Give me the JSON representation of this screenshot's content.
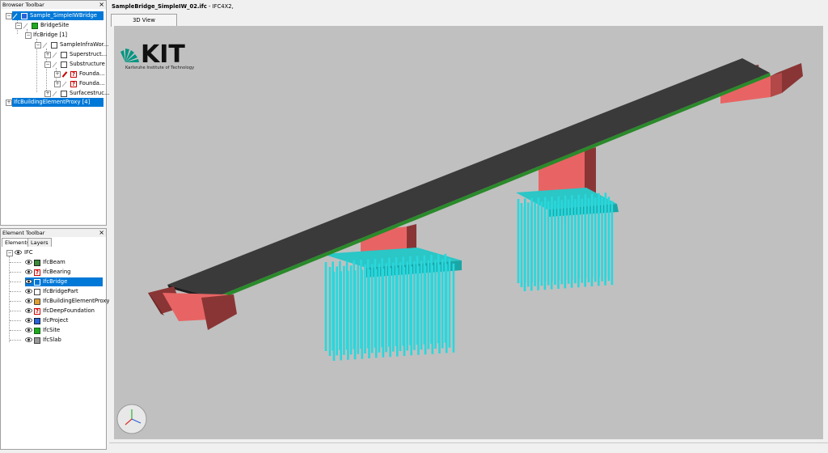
{
  "browser_toolbar": {
    "title": "Browser Toolbar",
    "close": "×",
    "items": [
      {
        "label": "Sample_SimpleIWBridge"
      },
      {
        "label": "BridgeSite"
      },
      {
        "label": "IfcBridge [1]"
      },
      {
        "label": "SampleInfraWor..."
      },
      {
        "label": "Superstruct..."
      },
      {
        "label": "Substructure"
      },
      {
        "label": "Founda..."
      },
      {
        "label": "Founda..."
      },
      {
        "label": "Surfacestruc..."
      },
      {
        "label": "IfcBuildingElementProxy [4]"
      }
    ]
  },
  "element_toolbar": {
    "title": "Element Toolbar",
    "close": "×",
    "tabs": [
      "Elements",
      "Layers"
    ],
    "root": "IFC",
    "items": [
      {
        "label": "IfcBeam"
      },
      {
        "label": "IfcBearing"
      },
      {
        "label": "IfcBridge"
      },
      {
        "label": "IfcBridgePart"
      },
      {
        "label": "IfcBuildingElementProxy"
      },
      {
        "label": "IfcDeepFoundation"
      },
      {
        "label": "IfcProject"
      },
      {
        "label": "IfcSite"
      },
      {
        "label": "IfcSlab"
      }
    ]
  },
  "document": {
    "filename": "SampleBridge_SimpleIW_02.ifc",
    "schema": " - IFC4X2,"
  },
  "view_tab": "3D View",
  "logo": {
    "text": "KIT",
    "subtitle": "Karlsruhe Institute of Technology"
  },
  "colors": {
    "selection": "#0078d7",
    "deck": "#3a3a3a",
    "pier": "#e86464",
    "abutment_dark": "#8a3535",
    "piles": "#29d7dc",
    "cap": "#2bc6c6",
    "background": "#c0c0c0",
    "logo_green": "#009682"
  }
}
